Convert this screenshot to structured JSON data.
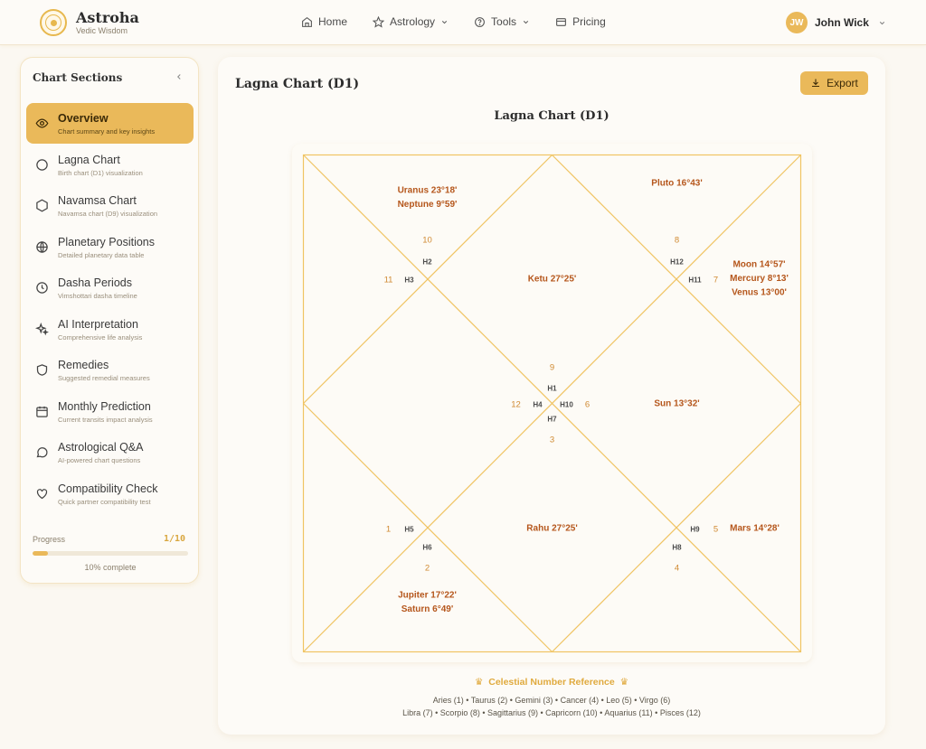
{
  "brand": {
    "name": "Astroha",
    "tagline": "Vedic Wisdom"
  },
  "nav": {
    "home": "Home",
    "astrology": "Astrology",
    "tools": "Tools",
    "pricing": "Pricing"
  },
  "user": {
    "initials": "JW",
    "name": "John Wick"
  },
  "sidebar": {
    "title": "Chart Sections",
    "items": [
      {
        "label": "Overview",
        "sub": "Chart summary and key insights",
        "icon": "eye-icon",
        "active": true
      },
      {
        "label": "Lagna Chart",
        "sub": "Birth chart (D1) visualization",
        "icon": "circle-icon"
      },
      {
        "label": "Navamsa Chart",
        "sub": "Navamsa chart (D9) visualization",
        "icon": "hexagon-icon"
      },
      {
        "label": "Planetary Positions",
        "sub": "Detailed planetary data table",
        "icon": "globe-icon"
      },
      {
        "label": "Dasha Periods",
        "sub": "Vimshottari dasha timeline",
        "icon": "clock-icon"
      },
      {
        "label": "AI Interpretation",
        "sub": "Comprehensive life analysis",
        "icon": "sparkles-icon"
      },
      {
        "label": "Remedies",
        "sub": "Suggested remedial measures",
        "icon": "shield-icon"
      },
      {
        "label": "Monthly Prediction",
        "sub": "Current transits impact analysis",
        "icon": "calendar-icon"
      },
      {
        "label": "Astrological Q&A",
        "sub": "AI-powered chart questions",
        "icon": "chat-icon"
      },
      {
        "label": "Compatibility Check",
        "sub": "Quick partner compatibility test",
        "icon": "heart-icon"
      }
    ],
    "progress": {
      "label": "Progress",
      "count": "1/10",
      "fraction": 0.1,
      "text": "10% complete"
    }
  },
  "main": {
    "title": "Lagna Chart (D1)",
    "export_label": "Export",
    "chart_heading": "Lagna Chart (D1)"
  },
  "chart": {
    "houses": [
      {
        "house": "H1",
        "sign": "9",
        "planets": [
          "Ketu 27°25'"
        ]
      },
      {
        "house": "H2",
        "sign": "10",
        "planets": [
          "Uranus 23°18'",
          "Neptune 9°59'"
        ]
      },
      {
        "house": "H3",
        "sign": "11",
        "planets": []
      },
      {
        "house": "H4",
        "sign": "12",
        "planets": []
      },
      {
        "house": "H5",
        "sign": "1",
        "planets": []
      },
      {
        "house": "H6",
        "sign": "2",
        "planets": [
          "Jupiter 17°22'",
          "Saturn 6°49'"
        ]
      },
      {
        "house": "H7",
        "sign": "3",
        "planets": [
          "Rahu 27°25'"
        ]
      },
      {
        "house": "H8",
        "sign": "4",
        "planets": []
      },
      {
        "house": "H9",
        "sign": "5",
        "planets": [
          "Mars 14°28'"
        ]
      },
      {
        "house": "H10",
        "sign": "6",
        "planets": [
          "Sun 13°32'"
        ]
      },
      {
        "house": "H11",
        "sign": "7",
        "planets": [
          "Moon 14°57'",
          "Mercury 8°13'",
          "Venus 13°00'"
        ]
      },
      {
        "house": "H12",
        "sign": "8",
        "planets": [
          "Pluto 16°43'"
        ]
      }
    ],
    "line_color": "#f0c463",
    "planet_color": "#b5561b",
    "sign_color": "#d08a32"
  },
  "reference": {
    "title": "Celestial Number Reference",
    "line1": "Aries (1) • Taurus (2) • Gemini (3) • Cancer (4) • Leo (5) • Virgo (6)",
    "line2": "Libra (7) • Scorpio (8) • Sagittarius (9) • Capricorn (10) • Aquarius (11) • Pisces (12)"
  }
}
